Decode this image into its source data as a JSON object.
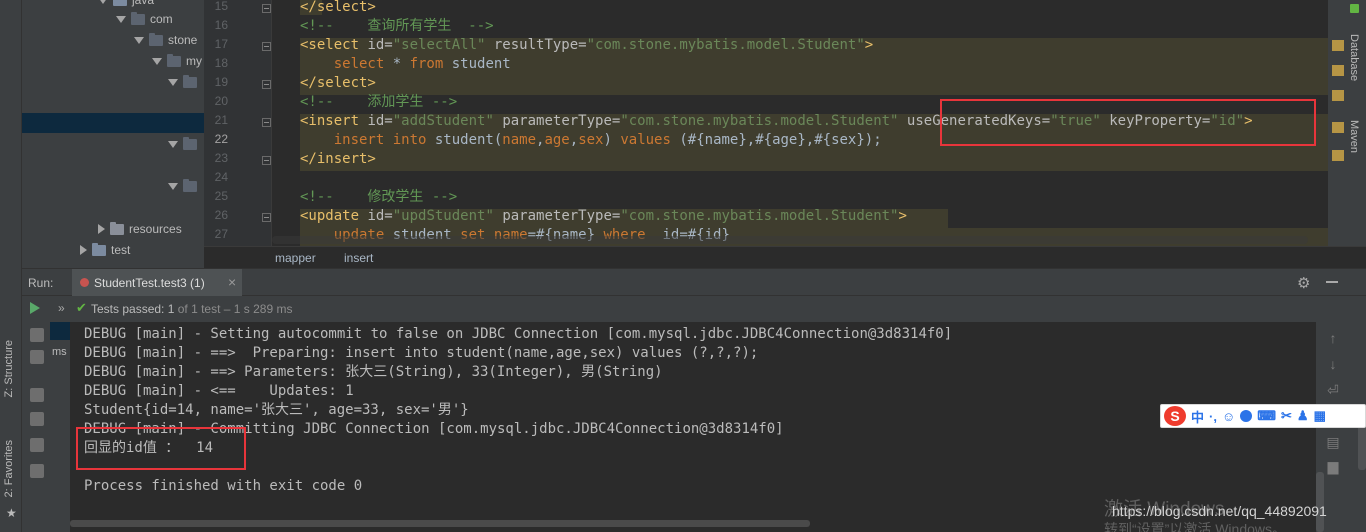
{
  "tree": {
    "items": [
      {
        "label": "java"
      },
      {
        "label": "com"
      },
      {
        "label": "stone"
      },
      {
        "label": "my"
      },
      {
        "label": "resources"
      },
      {
        "label": "test"
      }
    ]
  },
  "editor": {
    "line_numbers": [
      "15",
      "16",
      "17",
      "18",
      "19",
      "20",
      "21",
      "22",
      "23",
      "24",
      "25",
      "26",
      "27"
    ],
    "lines": [
      [
        {
          "t": "</select>",
          "c": "tag"
        }
      ],
      [
        {
          "t": "<!--    查询所有学生  -->",
          "c": "cmt"
        }
      ],
      [
        {
          "t": "<select ",
          "c": "tag"
        },
        {
          "t": "id=",
          "c": "attr"
        },
        {
          "t": "\"selectAll\"",
          "c": "val"
        },
        {
          "t": " resultType=",
          "c": "attr"
        },
        {
          "t": "\"com.stone.mybatis.model.Student\"",
          "c": "val"
        },
        {
          "t": ">",
          "c": "tag"
        }
      ],
      [
        {
          "t": "    select ",
          "c": "kw"
        },
        {
          "t": "* ",
          "c": "plain"
        },
        {
          "t": "from ",
          "c": "kw"
        },
        {
          "t": "student",
          "c": "plain"
        }
      ],
      [
        {
          "t": "</select>",
          "c": "tag"
        }
      ],
      [
        {
          "t": "<!--    添加学生 -->",
          "c": "cmt"
        }
      ],
      [
        {
          "t": "<insert ",
          "c": "tag"
        },
        {
          "t": "id=",
          "c": "attr"
        },
        {
          "t": "\"addStudent\"",
          "c": "val"
        },
        {
          "t": " parameterType=",
          "c": "attr"
        },
        {
          "t": "\"com.stone.mybatis.model.Student\"",
          "c": "val"
        },
        {
          "t": " useGeneratedKeys=",
          "c": "attr"
        },
        {
          "t": "\"true\"",
          "c": "val"
        },
        {
          "t": " keyProperty=",
          "c": "attr"
        },
        {
          "t": "\"id\"",
          "c": "val"
        },
        {
          "t": ">",
          "c": "tag"
        }
      ],
      [
        {
          "t": "    insert into ",
          "c": "kw"
        },
        {
          "t": "student(",
          "c": "plain"
        },
        {
          "t": "name",
          "c": "kw"
        },
        {
          "t": ",",
          "c": "plain"
        },
        {
          "t": "age",
          "c": "kw"
        },
        {
          "t": ",",
          "c": "plain"
        },
        {
          "t": "sex",
          "c": "kw"
        },
        {
          "t": ") ",
          "c": "plain"
        },
        {
          "t": "values ",
          "c": "kw"
        },
        {
          "t": "(#{name},#{age},#{sex});",
          "c": "plain"
        }
      ],
      [
        {
          "t": "</insert>",
          "c": "tag"
        }
      ],
      [
        {
          "t": "",
          "c": "plain"
        }
      ],
      [
        {
          "t": "<!--    修改学生 -->",
          "c": "cmt"
        }
      ],
      [
        {
          "t": "<update ",
          "c": "tag"
        },
        {
          "t": "id=",
          "c": "attr"
        },
        {
          "t": "\"updStudent\"",
          "c": "val"
        },
        {
          "t": " parameterType=",
          "c": "attr"
        },
        {
          "t": "\"com.stone.mybatis.model.Student\"",
          "c": "val"
        },
        {
          "t": ">",
          "c": "tag"
        }
      ],
      [
        {
          "t": "    update ",
          "c": "kw"
        },
        {
          "t": "student ",
          "c": "plain"
        },
        {
          "t": "set ",
          "c": "kw"
        },
        {
          "t": "name",
          "c": "kw"
        },
        {
          "t": "=#{name} ",
          "c": "plain"
        },
        {
          "t": "where  ",
          "c": "kw"
        },
        {
          "t": "id=#{id}",
          "c": "plain"
        }
      ]
    ]
  },
  "right_tabs": {
    "database": "Database",
    "maven": "Maven"
  },
  "left_tabs": {
    "structure": "Z: Structure",
    "favorites": "2: Favorites"
  },
  "breadcrumb": [
    "mapper",
    "insert"
  ],
  "run": {
    "label": "Run:",
    "tab": "StudentTest.test3 (1)",
    "close": "×",
    "status_prefix": "Tests passed: ",
    "status_count": "1",
    "status_suffix": " of 1 test – 1 s 289 ms",
    "ms_labels": [
      "ms",
      "ms"
    ]
  },
  "console": {
    "lines": [
      "DEBUG [main] - Setting autocommit to false on JDBC Connection [com.mysql.jdbc.JDBC4Connection@3d8314f0]",
      "DEBUG [main] - ==>  Preparing: insert into student(name,age,sex) values (?,?,?);",
      "DEBUG [main] - ==> Parameters: 张大三(String), 33(Integer), 男(String)",
      "DEBUG [main] - <==    Updates: 1",
      "Student{id=14, name='张大三', age=33, sex='男'}",
      "DEBUG [main] - Committing JDBC Connection [com.mysql.jdbc.JDBC4Connection@3d8314f0]",
      "回显的id值 ：  14",
      "",
      "Process finished with exit code 0"
    ]
  },
  "ime": {
    "logo": "S",
    "lang": "中"
  },
  "watermark": {
    "activate": "激活 Windows",
    "url": "https://blog.csdn.net/qq_44892091",
    "goto": "转到“设置”以激活 Windows。"
  }
}
